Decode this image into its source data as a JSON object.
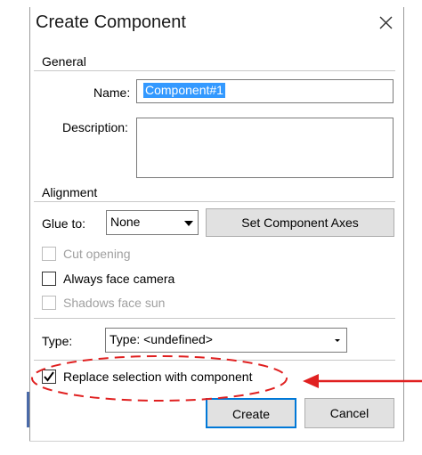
{
  "dialog": {
    "title": "Create Component"
  },
  "general": {
    "heading": "General",
    "name_label": "Name:",
    "name_value": "Component#1",
    "description_label": "Description:",
    "description_value": ""
  },
  "alignment": {
    "heading": "Alignment",
    "glue_label": "Glue to:",
    "glue_value": "None",
    "set_axes_label": "Set Component Axes",
    "cut_opening_label": "Cut opening",
    "always_face_camera_label": "Always face camera",
    "shadows_face_sun_label": "Shadows face sun"
  },
  "type": {
    "label": "Type:",
    "value": "Type: <undefined>"
  },
  "replace": {
    "label": "Replace selection with component",
    "checked": true
  },
  "buttons": {
    "create_label": "Create",
    "cancel_label": "Cancel"
  },
  "annotation": {
    "color": "#e02020"
  }
}
